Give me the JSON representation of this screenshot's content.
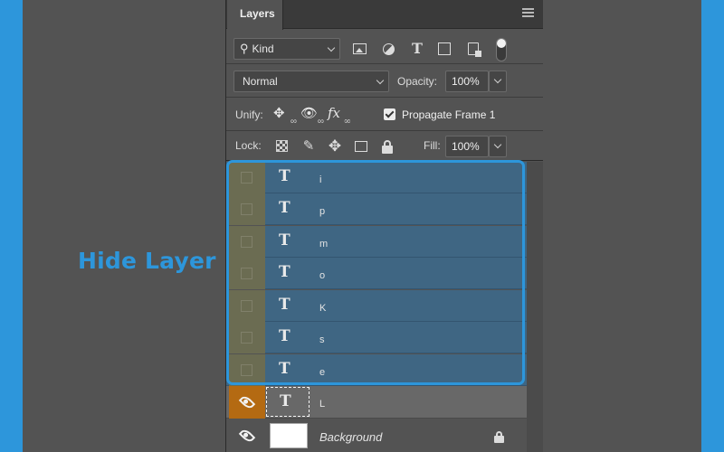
{
  "annotation": {
    "text": "Hide Layer",
    "color": "#2d96db"
  },
  "panel": {
    "tab_label": "Layers",
    "menu_icon": "hamburger-icon"
  },
  "filter_row": {
    "kind_label": "Kind",
    "icons": [
      "search-icon",
      "pixel-layer-filter-icon",
      "adjustment-layer-filter-icon",
      "type-layer-filter-icon",
      "shape-layer-filter-icon",
      "smart-object-filter-icon"
    ],
    "type_glyph": "T",
    "filter_toggle": "on"
  },
  "blend_row": {
    "mode": "Normal",
    "opacity_label": "Opacity:",
    "opacity_value": "100%"
  },
  "unify_row": {
    "label": "Unify:",
    "style_glyph": "fx",
    "propagate_label": "Propagate Frame 1",
    "propagate_checked": true
  },
  "lock_row": {
    "label": "Lock:",
    "fill_label": "Fill:",
    "fill_value": "100%"
  },
  "layers": [
    {
      "name": "i",
      "type": "text",
      "visible": false,
      "selected": true
    },
    {
      "name": "p",
      "type": "text",
      "visible": false,
      "selected": true
    },
    {
      "name": "m",
      "type": "text",
      "visible": false,
      "selected": true
    },
    {
      "name": "o",
      "type": "text",
      "visible": false,
      "selected": true
    },
    {
      "name": "K",
      "type": "text",
      "visible": false,
      "selected": true
    },
    {
      "name": "s",
      "type": "text",
      "visible": false,
      "selected": true
    },
    {
      "name": "e",
      "type": "text",
      "visible": false,
      "selected": true
    },
    {
      "name": "L",
      "type": "text",
      "visible": true,
      "selected": false
    },
    {
      "name": "Background",
      "type": "background",
      "visible": true,
      "locked": true
    }
  ],
  "text_glyph": "T",
  "colors": {
    "selection_highlight": "#3f6683",
    "hidden_vis_column": "#6b6c52",
    "active_vis_column": "#b46a12",
    "accent_frame": "#2d96db"
  }
}
